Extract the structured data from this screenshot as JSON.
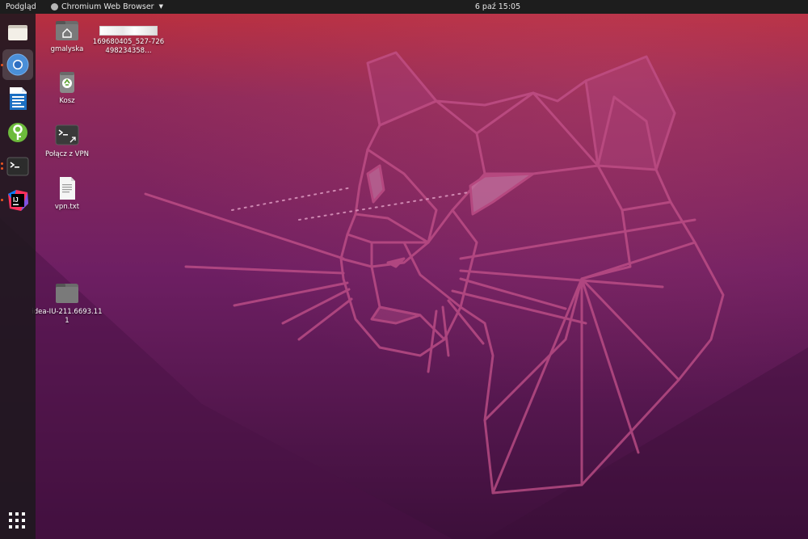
{
  "topbar": {
    "activities_label": "Podgląd",
    "app_name": "Chromium Web Browser",
    "clock": "6 paź  15:05"
  },
  "dock": {
    "items": [
      {
        "name": "files",
        "icon": "folder-icon"
      },
      {
        "name": "chromium",
        "icon": "chromium-icon"
      },
      {
        "name": "libreoffice-writer",
        "icon": "writer-icon"
      },
      {
        "name": "keepass",
        "icon": "key-icon"
      },
      {
        "name": "terminal",
        "icon": "terminal-icon"
      },
      {
        "name": "intellij-idea",
        "icon": "intellij-icon"
      }
    ],
    "show_apps_icon": "grid-icon"
  },
  "desktop": {
    "icons": [
      {
        "label": "gmalyska",
        "icon": "home-folder-icon"
      },
      {
        "label": "169680405_527-726498234358…",
        "icon": "image-file-icon"
      },
      {
        "label": "Kosz",
        "icon": "trash-icon"
      },
      {
        "label": "Połącz z VPN",
        "icon": "terminal-shortcut-icon"
      },
      {
        "label": "vpn.txt",
        "icon": "text-file-icon"
      },
      {
        "label": "idea-IU-211.6693.111",
        "icon": "folder-icon"
      }
    ]
  },
  "colors": {
    "topbar": "#1d1d1d",
    "dock": "#1e181e",
    "accent": "#e95420",
    "wallpaper_top": "#c0303a",
    "wallpaper_mid": "#7a2468",
    "wallpaper_bottom": "#3c0f3a"
  }
}
